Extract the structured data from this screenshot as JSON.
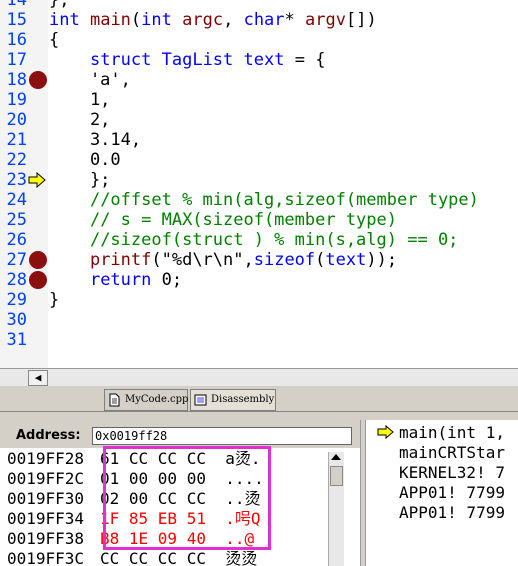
{
  "editor": {
    "lines": [
      {
        "num": "14",
        "tokens": [
          [
            "plain",
            "};"
          ]
        ]
      },
      {
        "num": "15",
        "tokens": [
          [
            "kw",
            "int"
          ],
          [
            "plain",
            " "
          ],
          [
            "str",
            "main"
          ],
          [
            "plain",
            "("
          ],
          [
            "kw",
            "int"
          ],
          [
            "plain",
            " "
          ],
          [
            "str",
            "argc"
          ],
          [
            "plain",
            ", "
          ],
          [
            "kw",
            "char"
          ],
          [
            "plain",
            "* "
          ],
          [
            "str",
            "argv"
          ],
          [
            "plain",
            "[])"
          ]
        ]
      },
      {
        "num": "16",
        "tokens": [
          [
            "plain",
            "{"
          ]
        ]
      },
      {
        "num": "17",
        "tokens": [
          [
            "plain",
            "    "
          ],
          [
            "kw",
            "struct"
          ],
          [
            "plain",
            " "
          ],
          [
            "kw",
            "TagList"
          ],
          [
            "plain",
            " "
          ],
          [
            "kw",
            "text"
          ],
          [
            "plain",
            " = {"
          ]
        ]
      },
      {
        "num": "18",
        "tokens": [
          [
            "plain",
            "    'a',"
          ]
        ]
      },
      {
        "num": "19",
        "tokens": [
          [
            "plain",
            "    1,"
          ]
        ]
      },
      {
        "num": "20",
        "tokens": [
          [
            "plain",
            "    2,"
          ]
        ]
      },
      {
        "num": "21",
        "tokens": [
          [
            "plain",
            "    3.14,"
          ]
        ]
      },
      {
        "num": "22",
        "tokens": [
          [
            "plain",
            "    0.0"
          ]
        ]
      },
      {
        "num": "23",
        "tokens": [
          [
            "plain",
            "    };"
          ]
        ]
      },
      {
        "num": "24",
        "tokens": [
          [
            "plain",
            "    "
          ],
          [
            "cm",
            "//offset % min(alg,sizeof(member type)"
          ]
        ]
      },
      {
        "num": "25",
        "tokens": [
          [
            "plain",
            "    "
          ],
          [
            "cm",
            "// s = MAX(sizeof(member type)"
          ]
        ]
      },
      {
        "num": "26",
        "tokens": [
          [
            "plain",
            "    "
          ],
          [
            "cm",
            "//sizeof(struct ) % min(s,alg) == 0;"
          ]
        ]
      },
      {
        "num": "27",
        "tokens": [
          [
            "plain",
            "    "
          ],
          [
            "str",
            "printf"
          ],
          [
            "plain",
            "(\"%d\\r\\n\","
          ],
          [
            "kw",
            "sizeof"
          ],
          [
            "plain",
            "("
          ],
          [
            "kw",
            "text"
          ],
          [
            "plain",
            "));"
          ]
        ]
      },
      {
        "num": "28",
        "tokens": [
          [
            "plain",
            "    "
          ],
          [
            "kw",
            "return"
          ],
          [
            "plain",
            " 0;"
          ]
        ]
      },
      {
        "num": "29",
        "tokens": [
          [
            "plain",
            "}"
          ]
        ]
      },
      {
        "num": "30",
        "tokens": []
      },
      {
        "num": "31",
        "tokens": []
      }
    ],
    "breakpoint_lines": [
      "18",
      "27",
      "28"
    ],
    "current_line": "23"
  },
  "hscroll_arrow": "◀",
  "tabs": [
    {
      "label": "MyCode.cpp",
      "icon": "document-icon"
    },
    {
      "label": "Disassembly",
      "icon": "disassembly-icon"
    }
  ],
  "memory": {
    "label": "Address:",
    "address_value": "0x0019ff28",
    "rows": [
      {
        "addr": "0019FF28",
        "bytes": "61 CC CC CC",
        "ascii": "a烫.",
        "red": false
      },
      {
        "addr": "0019FF2C",
        "bytes": "01 00 00 00",
        "ascii": "....",
        "red": false
      },
      {
        "addr": "0019FF30",
        "bytes": "02 00 CC CC",
        "ascii": "..烫",
        "red": false
      },
      {
        "addr": "0019FF34",
        "bytes": "1F 85 EB 51",
        "ascii": ".呺Q",
        "red": true
      },
      {
        "addr": "0019FF38",
        "bytes": "B8 1E 09 40",
        "ascii": "..@",
        "red": true
      },
      {
        "addr": "0019FF3C",
        "bytes": "CC CC CC CC",
        "ascii": "烫烫",
        "red": false
      }
    ]
  },
  "callstack": {
    "frames": [
      "main(int 1,",
      "mainCRTStar",
      "KERNEL32! 7",
      "APP01! 7799",
      "APP01! 7799"
    ]
  },
  "colors": {
    "keyword": "#0000ff",
    "identifier": "#800000",
    "comment": "#008000",
    "line_number": "#0040ff",
    "breakpoint": "#8a0f0f",
    "highlight_box": "#e030d0",
    "changed_memory": "#ff0000"
  }
}
